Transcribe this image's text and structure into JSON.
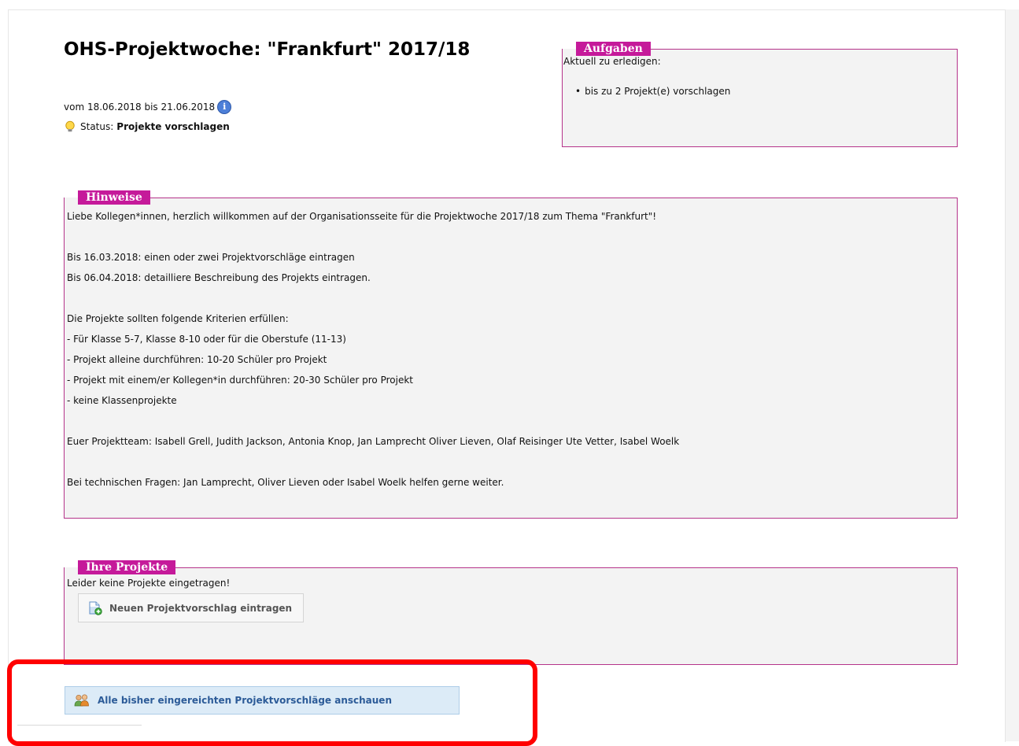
{
  "project": {
    "title": "OHS-Projektwoche: \"Frankfurt\" 2017/18",
    "date_range": "vom 18.06.2018 bis 21.06.2018",
    "info_icon": "info-icon",
    "status_label": "Status:",
    "status_value": "Projekte vorschlagen",
    "status_icon": "lightbulb-icon"
  },
  "aufgaben": {
    "legend": "Aufgaben",
    "intro": "Aktuell zu erledigen:",
    "items": [
      "bis zu 2 Projekt(e) vorschlagen"
    ]
  },
  "hinweise": {
    "legend": "Hinweise",
    "lines": [
      "Liebe Kollegen*innen, herzlich willkommen auf der Organisationsseite für die Projektwoche 2017/18 zum Thema \"Frankfurt\"!",
      "",
      "Bis 16.03.2018: einen oder zwei Projektvorschläge eintragen",
      "Bis 06.04.2018: detailliere Beschreibung des Projekts eintragen.",
      "",
      "Die Projekte sollten folgende Kriterien erfüllen:",
      "- Für Klasse 5-7, Klasse 8-10 oder für die Oberstufe (11-13)",
      "- Projekt alleine durchführen: 10-20 Schüler pro Projekt",
      "- Projekt mit einem/er Kollegen*in durchführen: 20-30 Schüler pro Projekt",
      "- keine Klassenprojekte",
      "",
      "Euer Projektteam: Isabell Grell, Judith Jackson, Antonia Knop, Jan Lamprecht Oliver Lieven, Olaf Reisinger Ute Vetter, Isabel Woelk",
      "",
      "Bei technischen Fragen: Jan Lamprecht, Oliver Lieven oder Isabel Woelk helfen gerne weiter."
    ]
  },
  "projekte": {
    "legend": "Ihre Projekte",
    "empty_text": "Leider keine Projekte eingetragen!",
    "new_button_label": "Neuen Projektvorschlag eintragen",
    "new_button_icon": "add-document-icon"
  },
  "all_proposals": {
    "button_label": "Alle bisher eingereichten Projektvorschläge anschauen",
    "icon": "users-group-icon"
  },
  "colors": {
    "legend_bg": "#c51a9a",
    "box_border": "#b5338a",
    "box_bg": "#f3f3f3",
    "button_blue_bg": "#dcebf7",
    "button_blue_text": "#2c5b98",
    "highlight": "#ff0000"
  }
}
